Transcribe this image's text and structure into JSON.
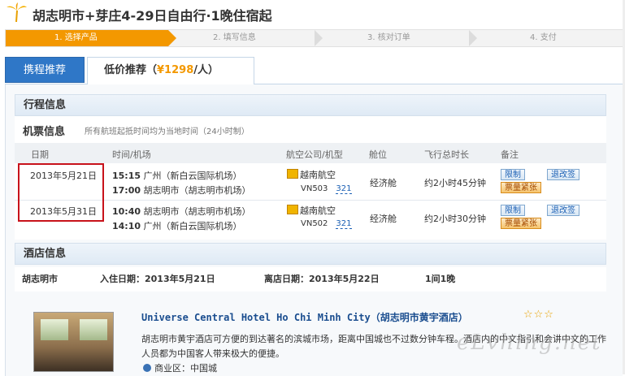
{
  "header": {
    "logo_icon": "palm-tree-icon",
    "title": "胡志明市+芽庄4-29日自由行·1晚住宿起"
  },
  "steps": [
    {
      "label": "1. 选择产品",
      "active": true
    },
    {
      "label": "2. 填写信息",
      "active": false
    },
    {
      "label": "3. 核对订单",
      "active": false
    },
    {
      "label": "4. 支付",
      "active": false
    }
  ],
  "tabs": {
    "tab1": "携程推荐",
    "tab2_prefix": "低价推荐（",
    "tab2_price": "¥1298",
    "tab2_suffix": "/人）"
  },
  "itinerary": {
    "section_title": "行程信息",
    "ticket_title": "机票信息",
    "ticket_note": "所有航班起抵时间均为当地时间（24小时制）",
    "columns": [
      "日期",
      "时间/机场",
      "航空公司/机型",
      "舱位",
      "飞行总时长",
      "备注"
    ],
    "flights": [
      {
        "date": "2013年5月21日",
        "dep_time": "15:15",
        "dep_airport": "广州（新白云国际机场）",
        "arr_time": "17:00",
        "arr_airport": "胡志明市（胡志明市机场）",
        "airline": "越南航空",
        "flight_no": "VN503",
        "aircraft": "321",
        "cabin": "经济舱",
        "duration": "约2小时45分钟",
        "tag_limit": "限制",
        "tag_change": "退改签",
        "tag_hot": "票量紧张"
      },
      {
        "date": "2013年5月31日",
        "dep_time": "10:40",
        "dep_airport": "胡志明市（胡志明市机场）",
        "arr_time": "14:10",
        "arr_airport": "广州（新白云国际机场）",
        "airline": "越南航空",
        "flight_no": "VN502",
        "aircraft": "321",
        "cabin": "经济舱",
        "duration": "约2小时30分钟",
        "tag_limit": "限制",
        "tag_change": "退改签",
        "tag_hot": "票量紧张"
      }
    ]
  },
  "hotel": {
    "section_title": "酒店信息",
    "city": "胡志明市",
    "checkin": "入住日期：2013年5月21日",
    "checkout": "离店日期：2013年5月22日",
    "rooms": "1间1晚",
    "name": "Universe Central Hotel Ho Chi Minh City（胡志明市黄宇酒店）",
    "stars": "☆☆☆",
    "description": "胡志明市黄宇酒店可方便的到达著名的滨城市场，距离中国城也不过数分钟车程。酒店内的中文指引和会讲中文的工作人员都为中国客人带来极大的便捷。",
    "area": "商业区：中国城"
  },
  "watermark": "eLvhing.net"
}
